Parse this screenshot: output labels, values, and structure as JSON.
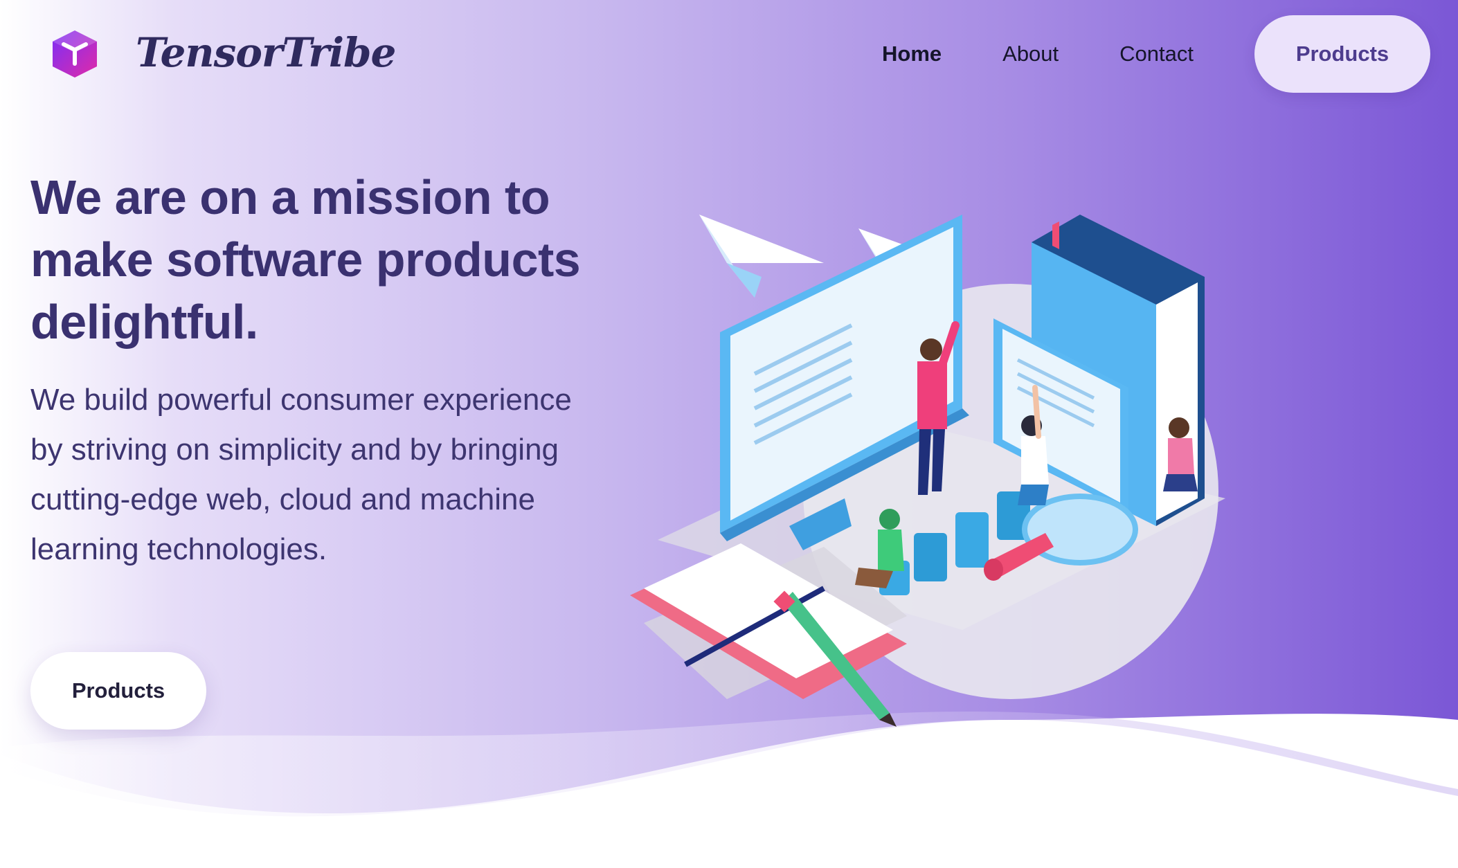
{
  "header": {
    "brand": "TensorTribe",
    "nav": [
      {
        "label": "Home",
        "active": true
      },
      {
        "label": "About",
        "active": false
      },
      {
        "label": "Contact",
        "active": false
      }
    ],
    "products_button": "Products"
  },
  "hero": {
    "headline": "We are on a mission to make software products delightful.",
    "subtext": "We build powerful consumer experience by striving on simplicity and by bringing cutting-edge web, cloud and machine learning technologies.",
    "cta_label": "Products"
  },
  "colors": {
    "gradient_start": "#ffffff",
    "gradient_mid": "#c8b8ef",
    "gradient_end": "#7b57d6",
    "heading": "#3a3170",
    "button_bg": "#ebe2fb",
    "logo_purple": "#7b2ff7",
    "logo_pink": "#e02aa8"
  },
  "icons": {
    "logo": "cube-icon"
  }
}
